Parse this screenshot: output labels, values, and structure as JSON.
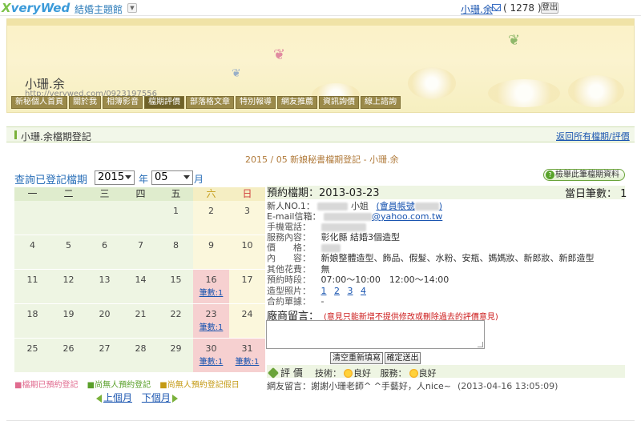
{
  "topbar": {
    "logo_prefix": "X",
    "logo_text": "veryWed",
    "theme_link": "結婚主題館",
    "user_name": "小珊.余",
    "mail_count": "( 1278 )",
    "logout": "登出"
  },
  "banner": {
    "blog_name": "小珊.余",
    "blog_url": "http://verywed.com/0923197556",
    "nav": [
      "新秘個人首頁",
      "關於我",
      "相簿影音",
      "檔期評價",
      "部落格文章",
      "特別報導",
      "網友推薦",
      "資訊詢價",
      "線上諮詢"
    ],
    "active_nav": "檔期評價"
  },
  "section": {
    "title": "小珊.余檔期登記",
    "back_link": "返回所有檔期/評價"
  },
  "subtitle": "2015 / 05 新娘秘書檔期登記 - 小珊.余",
  "query": {
    "label": "查詢已登記檔期",
    "year": "2015",
    "year_unit": "年",
    "month": "05",
    "month_unit": "月"
  },
  "report_button": "檢舉此筆檔期資料",
  "calendar": {
    "weekdays": [
      "一",
      "二",
      "三",
      "四",
      "五",
      "六",
      "日"
    ],
    "weeks": [
      [
        "",
        "",
        "",
        "",
        "1",
        "2",
        "3"
      ],
      [
        "4",
        "5",
        "6",
        "7",
        "8",
        "9",
        "10"
      ],
      [
        "11",
        "12",
        "13",
        "14",
        "15",
        "16",
        "17"
      ],
      [
        "18",
        "19",
        "20",
        "21",
        "22",
        "23",
        "24"
      ],
      [
        "25",
        "26",
        "27",
        "28",
        "29",
        "30",
        "31"
      ]
    ],
    "count_label": "筆數:1"
  },
  "legend": {
    "booked": "■檔期已預約登記",
    "none": "■尚無人預約登記",
    "holiday": "■尚無人預約登記假日"
  },
  "month_nav": {
    "prev": "上個月",
    "next": "下個月"
  },
  "detail": {
    "date_label": "預約檔期：2013-03-23",
    "daily_count": "當日筆數：  1",
    "newcomer_label": "新人NO.1：",
    "newcomer_suffix": "小姐",
    "member_label": "(會員帳號",
    "member_close": ")",
    "email_label": "E-mail信箱：",
    "email_domain": "@yahoo.com.tw",
    "phone_label": "手機電話：",
    "service_label": "服務內容：",
    "service_value": "彰化縣 結婚3個造型",
    "price_label": "價　　格：",
    "content_label": "內　　容：",
    "content_value": "新娘整體造型、飾品、假髮、水粉、安瓶、媽媽妝、新郎妝、新郎造型",
    "other_label": "其他花費：",
    "other_value": "無",
    "time_label": "預約時段：",
    "time_value": "07:00～10:00　12:00～14:00",
    "photo_label": "造型照片：",
    "photos": [
      "1",
      "2",
      "3",
      "4"
    ],
    "contract_label": "合約單據：",
    "contract_value": "-"
  },
  "message": {
    "label": "廠商留言：",
    "note": "(意見只能新增不提供修改或刪除過去的評價意見)",
    "clear_button": "清空重新填寫",
    "submit_button": "確定送出"
  },
  "evaluation": {
    "title": "評 價",
    "tech_label": "技術：",
    "tech_value": "良好",
    "service_label": "服務：",
    "service_value": "良好",
    "comment_label": "網友留言：",
    "comment_text": "謝謝小珊老師^ ^手藝好，人nice~",
    "comment_time": "(2013-04-16 13:05:09)"
  }
}
